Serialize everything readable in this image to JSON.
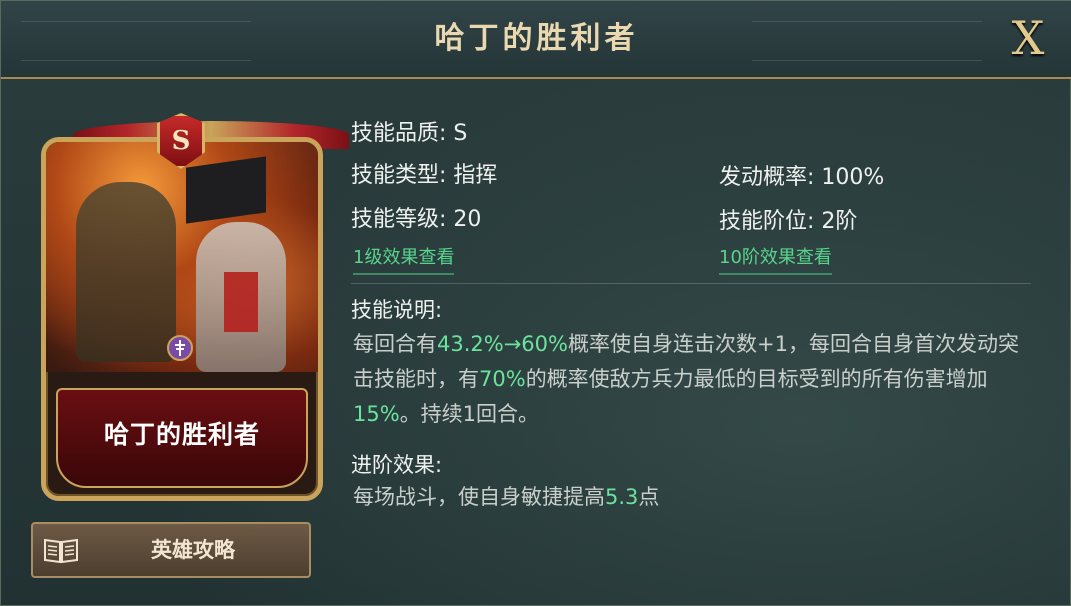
{
  "window": {
    "title": "哈丁的胜利者",
    "close_label": "X"
  },
  "card": {
    "grade": "S",
    "name": "哈丁的胜利者",
    "emblem_icon": "faction-emblem"
  },
  "guide_button": {
    "label": "英雄攻略",
    "icon": "book-icon"
  },
  "attributes": {
    "quality_label": "技能品质:",
    "quality_value": "S",
    "type_label": "技能类型:",
    "type_value": "指挥",
    "level_label": "技能等级:",
    "level_value": "20",
    "rate_label": "发动概率:",
    "rate_value": "100%",
    "tier_label": "技能阶位:",
    "tier_value": "2阶"
  },
  "links": {
    "level1": "1级效果查看",
    "tier10": "10阶效果查看"
  },
  "description": {
    "title": "技能说明:",
    "p1": "每回合有",
    "v1": "43.2%→60%",
    "p2": "概率使自身连击次数+1，每回合自身首次发动突击技能时，有",
    "v2": "70%",
    "p3": "的概率使敌方兵力最低的目标受到的所有伤害增加",
    "v3": "15%",
    "p4": "。持续1回合。"
  },
  "advance": {
    "title": "进阶效果:",
    "p1": "每场战斗，使自身敏捷提高",
    "v1": "5.3",
    "p2": "点"
  },
  "colors": {
    "highlight": "#6be39c",
    "gold": "#c9a45a",
    "title_text": "#ead8b0"
  }
}
